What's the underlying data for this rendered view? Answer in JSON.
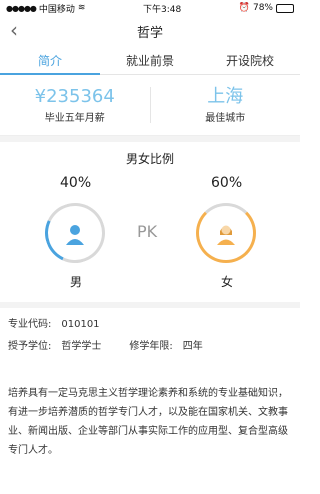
{
  "status": {
    "carrier": "中国移动",
    "time": "下午3:48",
    "battery": "78%"
  },
  "nav": {
    "title": "哲学",
    "back": "‹"
  },
  "tabs": [
    {
      "label": "简介"
    },
    {
      "label": "就业前景"
    },
    {
      "label": "开设院校"
    }
  ],
  "stats": {
    "salary": {
      "value": "¥235364",
      "label": "毕业五年月薪"
    },
    "city": {
      "value": "上海",
      "label": "最佳城市"
    }
  },
  "ratio": {
    "title": "男女比例",
    "male": {
      "percent": "40%",
      "label": "男",
      "value": 40
    },
    "female": {
      "percent": "60%",
      "label": "女",
      "value": 60
    },
    "pk": "PK"
  },
  "info": {
    "code_label": "专业代码:",
    "code": "010101",
    "degree_label": "授予学位:",
    "degree": "哲学学士",
    "years_label": "修学年限:",
    "years": "四年"
  },
  "description": "培养具有一定马克思主义哲学理论素养和系统的专业基础知识，有进一步培养潜质的哲学专门人才，以及能在国家机关、文教事业、新闻出版、企业等部门从事实际工作的应用型、复合型高级专门人才。"
}
